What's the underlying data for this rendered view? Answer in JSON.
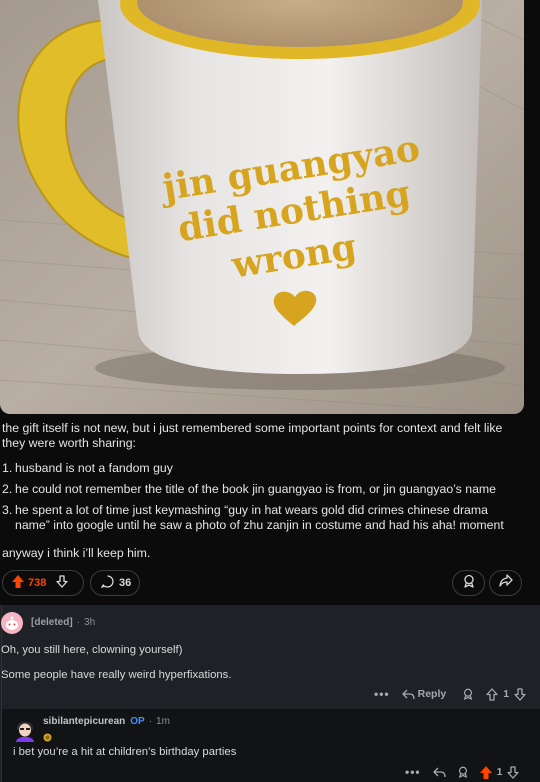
{
  "post": {
    "image_text": {
      "line1": "jin guangyao",
      "line2": "did nothing",
      "line3": "wrong"
    },
    "intro": "the gift itself is not new, but i just remembered some important points for context and felt like they were worth sharing:",
    "points": [
      {
        "num": "1.",
        "text": "husband is not a fandom guy"
      },
      {
        "num": "2.",
        "text": "he could not remember the title of the book jin guangyao is from, or jin guangyao’s name"
      },
      {
        "num": "3.",
        "text": "he spent a lot of time just keymashing “guy in hat wears gold did crimes chinese drama name” into google until he saw a photo of zhu zanjin in costume and had his aha! moment"
      }
    ],
    "closing": "anyway i think i’ll keep him.",
    "votes": "738",
    "comments": "36"
  },
  "comments": [
    {
      "author": "[deleted]",
      "time": "3h",
      "paragraphs": [
        "Oh, you still here, clowning yourself)",
        "Some people have really weird hyperfixations."
      ],
      "reply_label": "Reply",
      "votes": "1"
    },
    {
      "author": "sibilantepicurean",
      "op_badge": "OP",
      "time": "1m",
      "text": "i bet you’re a hit at children’s birthday parties",
      "votes": "1"
    }
  ],
  "colors": {
    "upvote": "#ff4500",
    "mug_text": "#d6a41f",
    "op_badge": "#4a8cff",
    "background": "#0b0b0b",
    "comment_panel": "#1e2226"
  },
  "icons": [
    "upvote-icon",
    "downvote-icon",
    "comment-icon",
    "award-icon",
    "share-icon",
    "reply-icon",
    "more-icon"
  ]
}
